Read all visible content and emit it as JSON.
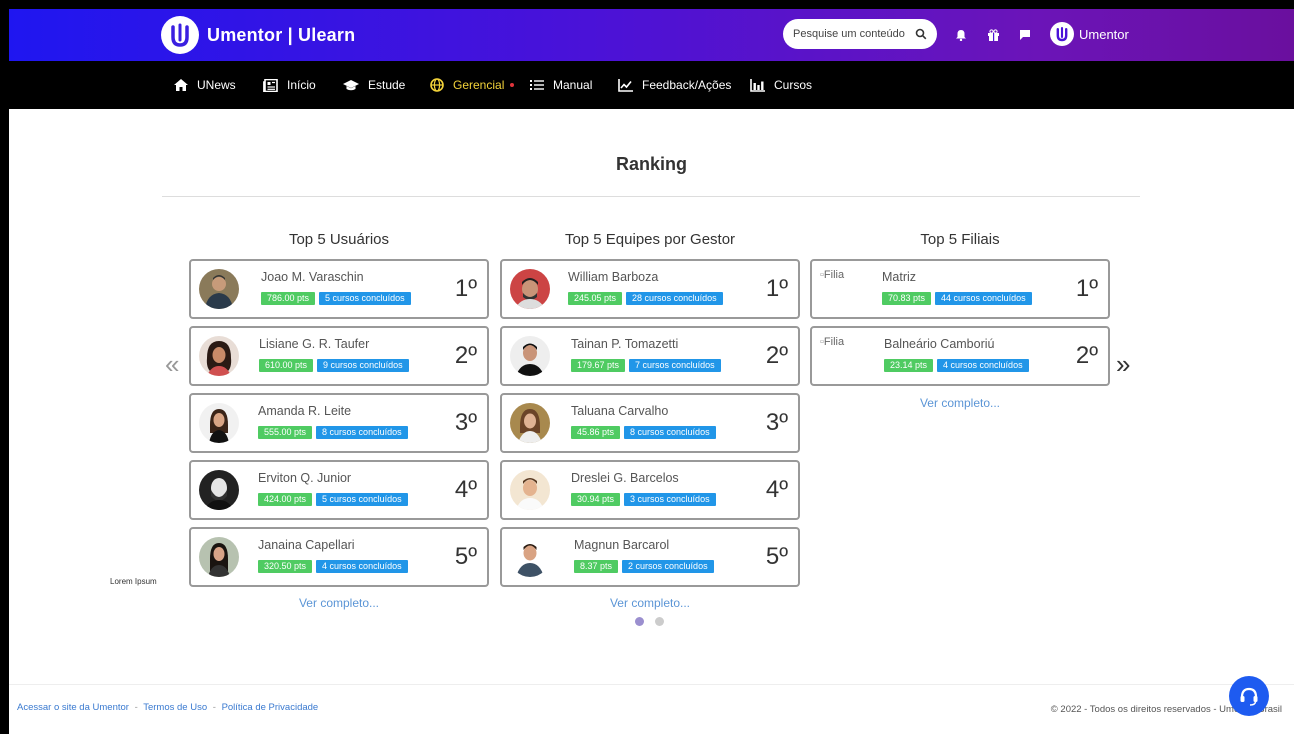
{
  "header": {
    "brand": "Umentor | Ulearn",
    "search_placeholder": "Pesquise um conteúdo",
    "user_name": "Umentor"
  },
  "nav": [
    {
      "label": "UNews",
      "icon": "home-icon"
    },
    {
      "label": "Início",
      "icon": "newspaper-icon"
    },
    {
      "label": "Estude",
      "icon": "graduation-cap-icon"
    },
    {
      "label": "Gerencial",
      "icon": "globe-icon",
      "active": true
    },
    {
      "label": "Manual",
      "icon": "list-icon"
    },
    {
      "label": "Feedback/Ações",
      "icon": "line-chart-icon"
    },
    {
      "label": "Cursos",
      "icon": "bar-chart-icon"
    }
  ],
  "page": {
    "title": "Ranking",
    "lorem": "Lorem Ipsum",
    "ver_completo": "Ver completo..."
  },
  "columns": [
    {
      "title": "Top 5 Usuários",
      "items": [
        {
          "name": "Joao M. Varaschin",
          "pts": "786.00 pts",
          "cursos": "5 cursos concluídos",
          "rank": "1º"
        },
        {
          "name": "Lisiane G. R. Taufer",
          "pts": "610.00 pts",
          "cursos": "9 cursos concluídos",
          "rank": "2º"
        },
        {
          "name": "Amanda R. Leite",
          "pts": "555.00 pts",
          "cursos": "8 cursos concluídos",
          "rank": "3º"
        },
        {
          "name": "Erviton Q. Junior",
          "pts": "424.00 pts",
          "cursos": "5 cursos concluídos",
          "rank": "4º"
        },
        {
          "name": "Janaina Capellari",
          "pts": "320.50 pts",
          "cursos": "4 cursos concluídos",
          "rank": "5º"
        }
      ]
    },
    {
      "title": "Top 5 Equipes por Gestor",
      "items": [
        {
          "name": "William Barboza",
          "pts": "245.05 pts",
          "cursos": "28 cursos concluídos",
          "rank": "1º"
        },
        {
          "name": "Tainan P. Tomazetti",
          "pts": "179.67 pts",
          "cursos": "7 cursos concluídos",
          "rank": "2º"
        },
        {
          "name": "Taluana Carvalho",
          "pts": "45.86 pts",
          "cursos": "8 cursos concluídos",
          "rank": "3º"
        },
        {
          "name": "Dreslei G. Barcelos",
          "pts": "30.94 pts",
          "cursos": "3 cursos concluídos",
          "rank": "4º"
        },
        {
          "name": "Magnun Barcarol",
          "pts": "8.37 pts",
          "cursos": "2 cursos concluídos",
          "rank": "5º"
        }
      ]
    },
    {
      "title": "Top 5 Filiais",
      "items": [
        {
          "name": "Matriz",
          "image_alt": "Filia",
          "pts": "70.83 pts",
          "cursos": "44 cursos concluídos",
          "rank": "1º"
        },
        {
          "name": "Balneário Camboriú",
          "image_alt": "Filia",
          "pts": "23.14 pts",
          "cursos": "4 cursos concluídos",
          "rank": "2º"
        }
      ]
    }
  ],
  "carousel": {
    "prev": "«",
    "next": "»"
  },
  "footer": {
    "links": [
      "Acessar o site da Umentor",
      "Termos de Uso",
      "Política de Privacidade"
    ],
    "separator": "-",
    "copyright": "© 2022 - Todos os direitos reservados - Umentor Brasil"
  },
  "colors": {
    "header_gradient_start": "#1f16f0",
    "header_gradient_end": "#6a0f9e",
    "points_badge": "#4fcb62",
    "courses_badge": "#2196e8",
    "active_nav": "#f3d33a",
    "link": "#5b95d6",
    "support_button": "#1e5bf0"
  }
}
